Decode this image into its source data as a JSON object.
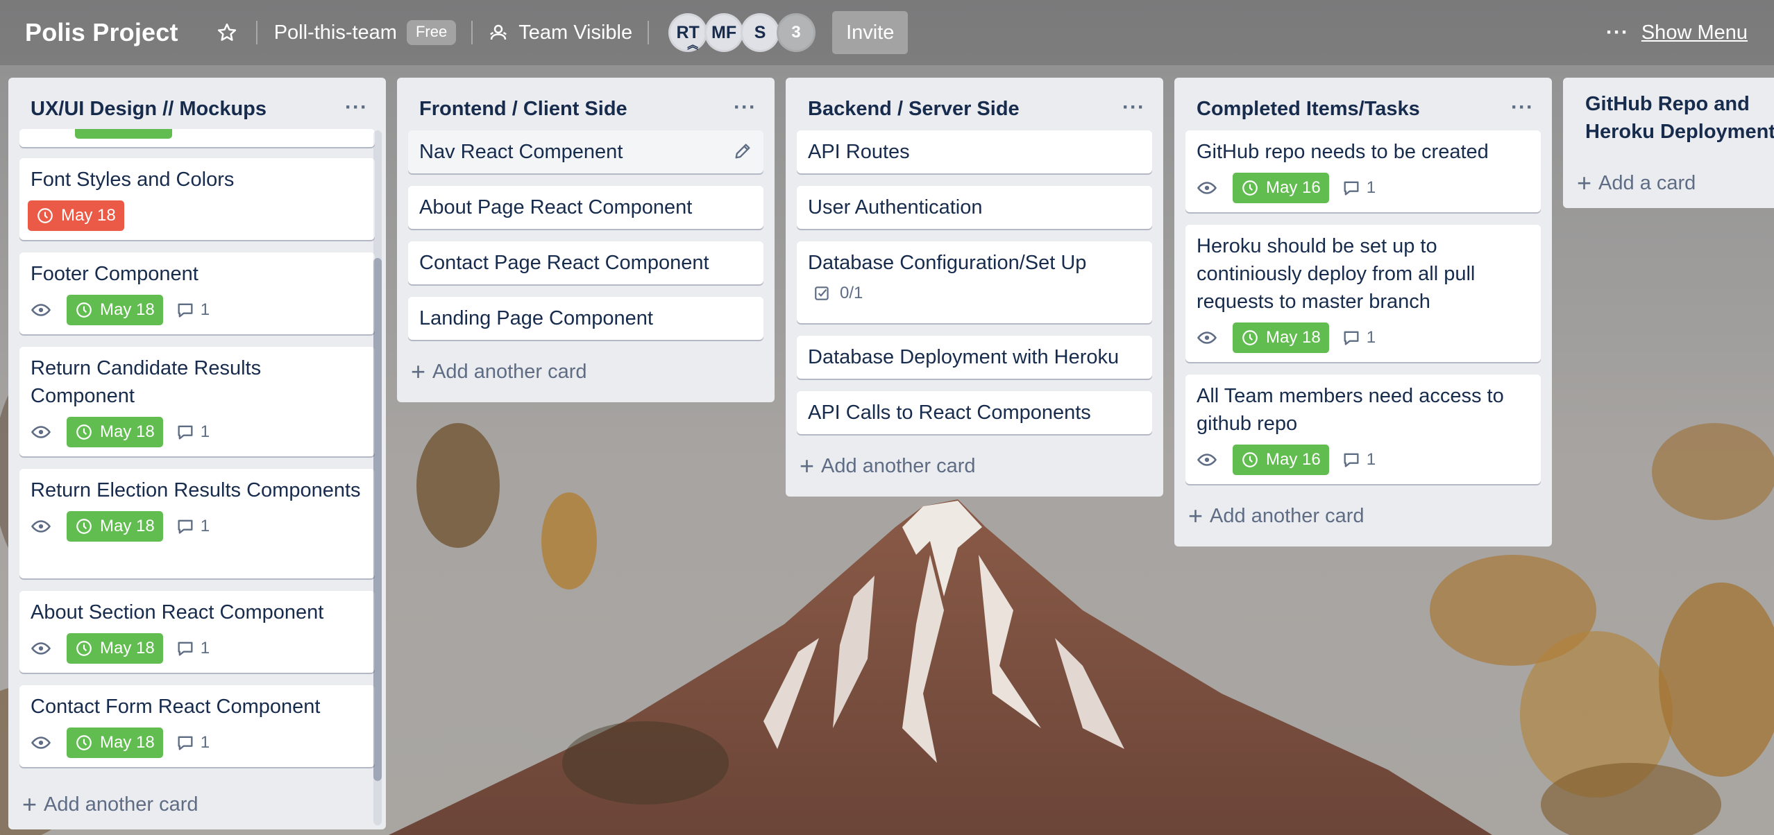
{
  "header": {
    "board_title": "Polis Project",
    "team_name": "Poll-this-team",
    "plan_badge": "Free",
    "visibility": "Team Visible",
    "members": [
      {
        "initials": "RT",
        "is_admin": true
      },
      {
        "initials": "MF",
        "is_admin": false
      },
      {
        "initials": "S",
        "is_admin": false
      }
    ],
    "more_members_count": "3",
    "invite_label": "Invite",
    "show_menu_label": "Show Menu"
  },
  "colors": {
    "due_soon_green": "#61bd4f",
    "overdue_red": "#eb5a46",
    "list_background": "#ebecf0",
    "card_background": "#ffffff"
  },
  "lists": [
    {
      "title": "UX/UI Design // Mockups",
      "add_label": "Add another card",
      "cards": [
        {
          "title": "Font Styles and Colors",
          "due": "May 18",
          "due_status": "overdue"
        },
        {
          "title": "Footer Component",
          "watching": true,
          "due": "May 18",
          "comments": "1"
        },
        {
          "title": "Return Candidate Results Component",
          "watching": true,
          "due": "May 18",
          "comments": "1"
        },
        {
          "title": "Return Election Results Components",
          "watching": true,
          "due": "May 18",
          "comments": "1"
        },
        {
          "title": "About Section React Component",
          "watching": true,
          "due": "May 18",
          "comments": "1"
        },
        {
          "title": "Contact Form React Component",
          "watching": true,
          "due": "May 18",
          "comments": "1"
        }
      ]
    },
    {
      "title": "Frontend / Client Side",
      "add_label": "Add another card",
      "cards": [
        {
          "title": "Nav React Compenent"
        },
        {
          "title": "About Page React Component"
        },
        {
          "title": "Contact Page React Component"
        },
        {
          "title": "Landing Page Component"
        }
      ]
    },
    {
      "title": "Backend / Server Side",
      "add_label": "Add another card",
      "cards": [
        {
          "title": "API Routes"
        },
        {
          "title": "User Authentication"
        },
        {
          "title": "Database Configuration/Set Up",
          "checklist": "0/1"
        },
        {
          "title": "Database Deployment with Heroku"
        },
        {
          "title": "API Calls to React Components"
        }
      ]
    },
    {
      "title": "Completed Items/Tasks",
      "add_label": "Add another card",
      "cards": [
        {
          "title": "GitHub repo needs to be created",
          "watching": true,
          "due": "May 16",
          "comments": "1"
        },
        {
          "title": "Heroku should be set up to continiously deploy from all pull requests to master branch",
          "watching": true,
          "due": "May 18",
          "comments": "1"
        },
        {
          "title": "All Team members need access to github repo",
          "watching": true,
          "due": "May 16",
          "comments": "1"
        }
      ]
    },
    {
      "title": "GitHub Repo and Heroku Deployment",
      "add_label": "Add a card",
      "cards": []
    }
  ]
}
